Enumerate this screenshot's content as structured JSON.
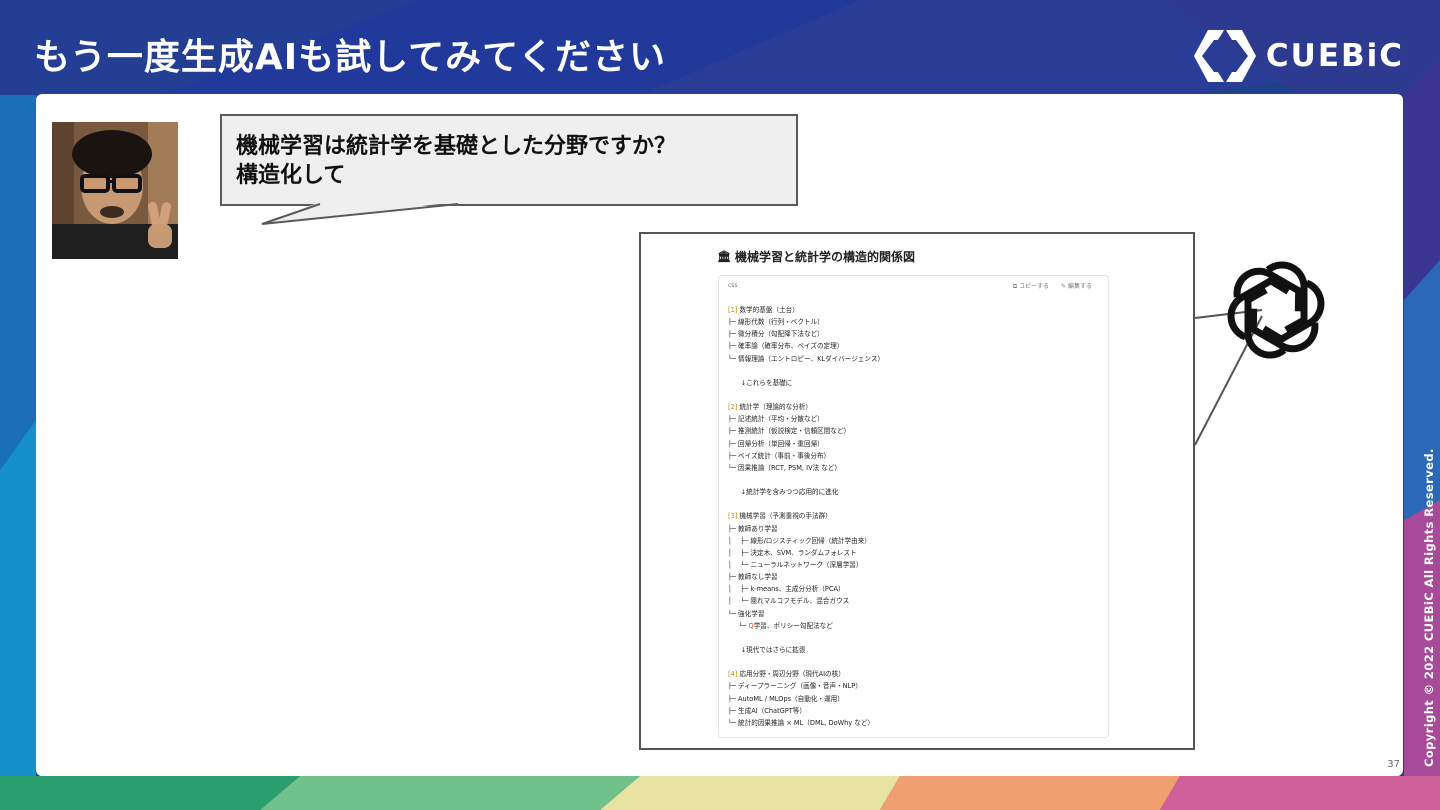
{
  "slide": {
    "title": "もう一度生成AIも試してみてください",
    "logo_text": "CUEBiC",
    "page_number": "37",
    "copyright": "Copyright © 2022 CUEBiC All Rights Reserved."
  },
  "prompt": {
    "line1": "機械学習は統計学を基礎とした分野ですか？",
    "line2": "構造化して"
  },
  "response": {
    "title": "機械学習と統計学の構造的関係図",
    "code_lang": "css",
    "copy_label": "コピーする",
    "edit_label": "編集する",
    "lines": [
      {
        "text": "[1] 数学的基盤（土台）"
      },
      {
        "text": "├─ 線形代数（行列・ベクトル）"
      },
      {
        "text": "├─ 微分積分（勾配降下法など）"
      },
      {
        "text": "├─ 確率論（確率分布、ベイズの定理）"
      },
      {
        "text": "└─ 情報理論（エントロピー、KLダイバージェンス）"
      },
      {
        "text": ""
      },
      {
        "text": "      ↓これらを基礎に"
      },
      {
        "text": ""
      },
      {
        "text": "[2] 統計学（理論的な分析）"
      },
      {
        "text": "├─ 記述統計（平均・分散など）"
      },
      {
        "text": "├─ 推測統計（仮説検定・信頼区間など）"
      },
      {
        "text": "├─ 回帰分析（単回帰・重回帰）"
      },
      {
        "text": "├─ ベイズ統計（事前・事後分布）"
      },
      {
        "text": "└─ 因果推論（RCT, PSM, IV法 など）"
      },
      {
        "text": ""
      },
      {
        "text": "      ↓統計学を含みつつ応用的に進化"
      },
      {
        "text": ""
      },
      {
        "text": "[3] 機械学習（予測重視の手法群）"
      },
      {
        "text": "├─ 教師あり学習"
      },
      {
        "text": "│    ├─ 線形/ロジスティック回帰（統計学由来）"
      },
      {
        "text": "│    ├─ 決定木、SVM、ランダムフォレスト"
      },
      {
        "text": "│    └─ ニューラルネットワーク（深層学習）"
      },
      {
        "text": "├─ 教師なし学習"
      },
      {
        "text": "│    ├─ k-means、主成分分析（PCA）"
      },
      {
        "text": "│    └─ 隠れマルコフモデル、混合ガウス"
      },
      {
        "text": "└─ 強化学習"
      },
      {
        "text": "     └─ Q学習、ポリシー勾配法など"
      },
      {
        "text": ""
      },
      {
        "text": "      ↓現代ではさらに拡張"
      },
      {
        "text": ""
      },
      {
        "text": "[4] 応用分野・周辺分野（現代AIの核）"
      },
      {
        "text": "├─ ディープラーニング（画像・音声・NLP）"
      },
      {
        "text": "├─ AutoML / MLOps（自動化・運用）"
      },
      {
        "text": "├─ 生成AI（ChatGPT等）"
      },
      {
        "text": "└─ 統計的因果推論 × ML（DML, DoWhy など）"
      }
    ]
  },
  "colors": {
    "brand_blue": "#1f3c8e",
    "tag_yellow": "#c48a00",
    "highlight_red": "#d23a2a"
  },
  "icons": [
    "cuebic-logo-icon",
    "openai-logo-icon",
    "bank-icon",
    "copy-icon",
    "edit-icon"
  ]
}
